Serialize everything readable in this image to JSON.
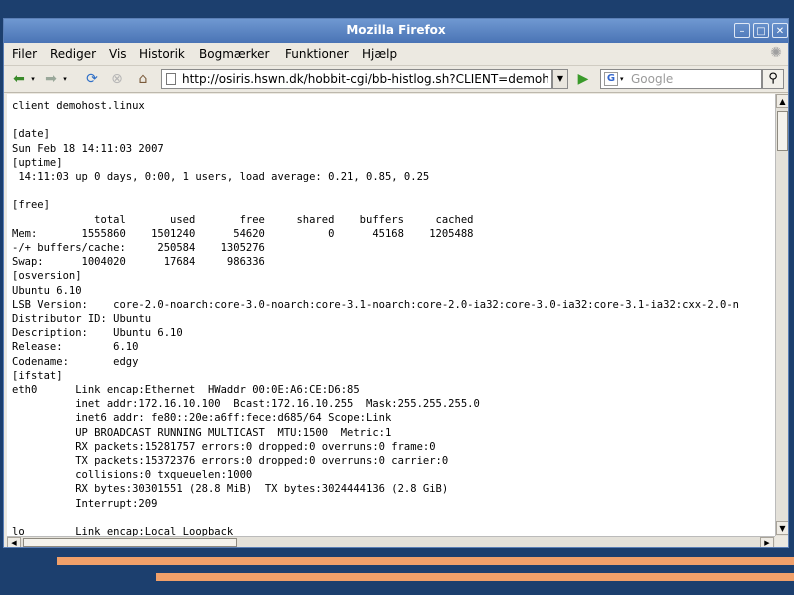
{
  "window": {
    "title": "Mozilla Firefox"
  },
  "menu": [
    {
      "label": "Filer"
    },
    {
      "label": "Rediger"
    },
    {
      "label": "Vis"
    },
    {
      "label": "Historik"
    },
    {
      "label": "Bogmærker"
    },
    {
      "label": "Funktioner"
    },
    {
      "label": "Hjælp"
    }
  ],
  "navigation": {
    "url": "http://osiris.hswn.dk/hobbit-cgi/bb-histlog.sh?CLIENT=demoh",
    "search_placeholder": "Google",
    "search_engine_icon": "google-icon"
  },
  "icons": {
    "back": "back-arrow-icon",
    "forward": "forward-arrow-icon",
    "reload": "reload-icon",
    "stop": "stop-icon",
    "home": "home-icon",
    "go": "go-arrow-icon",
    "search": "magnifier-icon"
  },
  "page": {
    "lines": [
      "client demohost.linux",
      "",
      "[date]",
      "Sun Feb 18 14:11:03 2007",
      "[uptime]",
      " 14:11:03 up 0 days, 0:00, 1 users, load average: 0.21, 0.85, 0.25",
      "",
      "[free]",
      "             total       used       free     shared    buffers     cached",
      "Mem:       1555860    1501240      54620          0      45168    1205488",
      "-/+ buffers/cache:     250584    1305276",
      "Swap:      1004020      17684     986336",
      "[osversion]",
      "Ubuntu 6.10",
      "LSB Version:    core-2.0-noarch:core-3.0-noarch:core-3.1-noarch:core-2.0-ia32:core-3.0-ia32:core-3.1-ia32:cxx-2.0-n",
      "Distributor ID: Ubuntu",
      "Description:    Ubuntu 6.10",
      "Release:        6.10",
      "Codename:       edgy",
      "[ifstat]",
      "eth0      Link encap:Ethernet  HWaddr 00:0E:A6:CE:D6:85",
      "          inet addr:172.16.10.100  Bcast:172.16.10.255  Mask:255.255.255.0",
      "          inet6 addr: fe80::20e:a6ff:fece:d685/64 Scope:Link",
      "          UP BROADCAST RUNNING MULTICAST  MTU:1500  Metric:1",
      "          RX packets:15281757 errors:0 dropped:0 overruns:0 frame:0",
      "          TX packets:15372376 errors:0 dropped:0 overruns:0 carrier:0",
      "          collisions:0 txqueuelen:1000",
      "          RX bytes:30301551 (28.8 MiB)  TX bytes:3024444136 (2.8 GiB)",
      "          Interrupt:209",
      "",
      "lo        Link encap:Local Loopback"
    ]
  },
  "colors": {
    "slide_background": "#1c3f6e",
    "slide_accent": "#f0a06a",
    "titlebar": "#4a74b5"
  }
}
